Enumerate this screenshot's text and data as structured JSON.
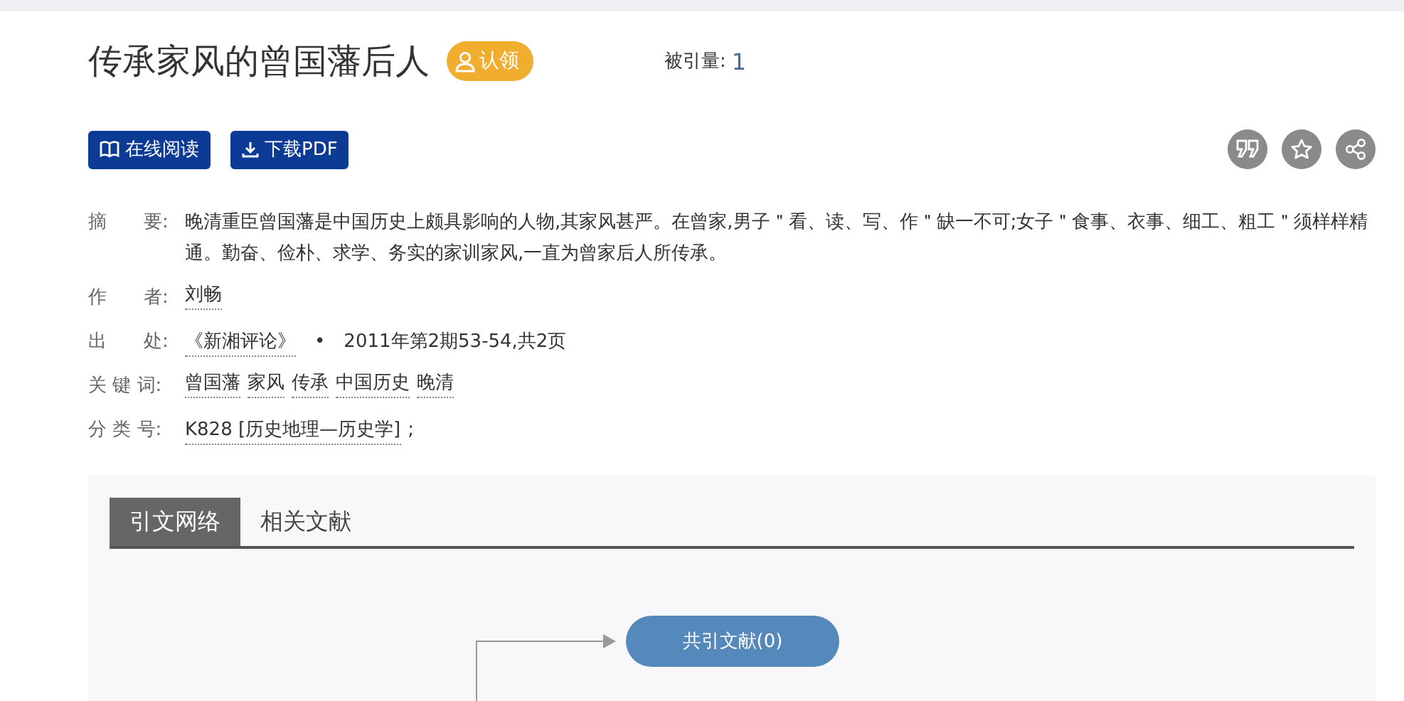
{
  "title": "传承家风的曾国藩后人",
  "claim_badge": "认领",
  "citations": {
    "label": "被引量:",
    "value": "1"
  },
  "buttons": [
    {
      "kind": "read",
      "label": "在线阅读"
    },
    {
      "kind": "download",
      "label": "下载PDF"
    }
  ],
  "actions": [
    {
      "kind": "quote"
    },
    {
      "kind": "favorite"
    },
    {
      "kind": "share"
    }
  ],
  "meta": [
    {
      "kind": "text",
      "label": "摘　　要:",
      "text": "晚清重臣曾国藩是中国历史上颇具影响的人物,其家风甚严。在曾家,男子＂看、读、写、作＂缺一不可;女子＂食事、衣事、细工、粗工＂须样样精通。勤奋、俭朴、求学、务实的家训家风,一直为曾家后人所传承。"
    },
    {
      "kind": "links",
      "label": "作　　者:",
      "links": [
        "刘畅"
      ]
    },
    {
      "kind": "source",
      "label": "出　　处:",
      "links": [
        "《新湘评论》"
      ],
      "separator": "•",
      "text": "2011年第2期53-54,共2页"
    },
    {
      "kind": "links",
      "label": "关 键 词:",
      "links": [
        "曾国藩",
        "家风",
        "传承",
        "中国历史",
        "晚清"
      ]
    },
    {
      "kind": "class",
      "label": "分 类 号:",
      "links": [
        "K828 [历史地理—历史学]"
      ],
      "text": ";"
    }
  ],
  "tabs": [
    {
      "label": "引文网络",
      "selected": true
    },
    {
      "label": "相关文献",
      "selected": false
    }
  ],
  "network": {
    "node": "共引文献(0)"
  }
}
